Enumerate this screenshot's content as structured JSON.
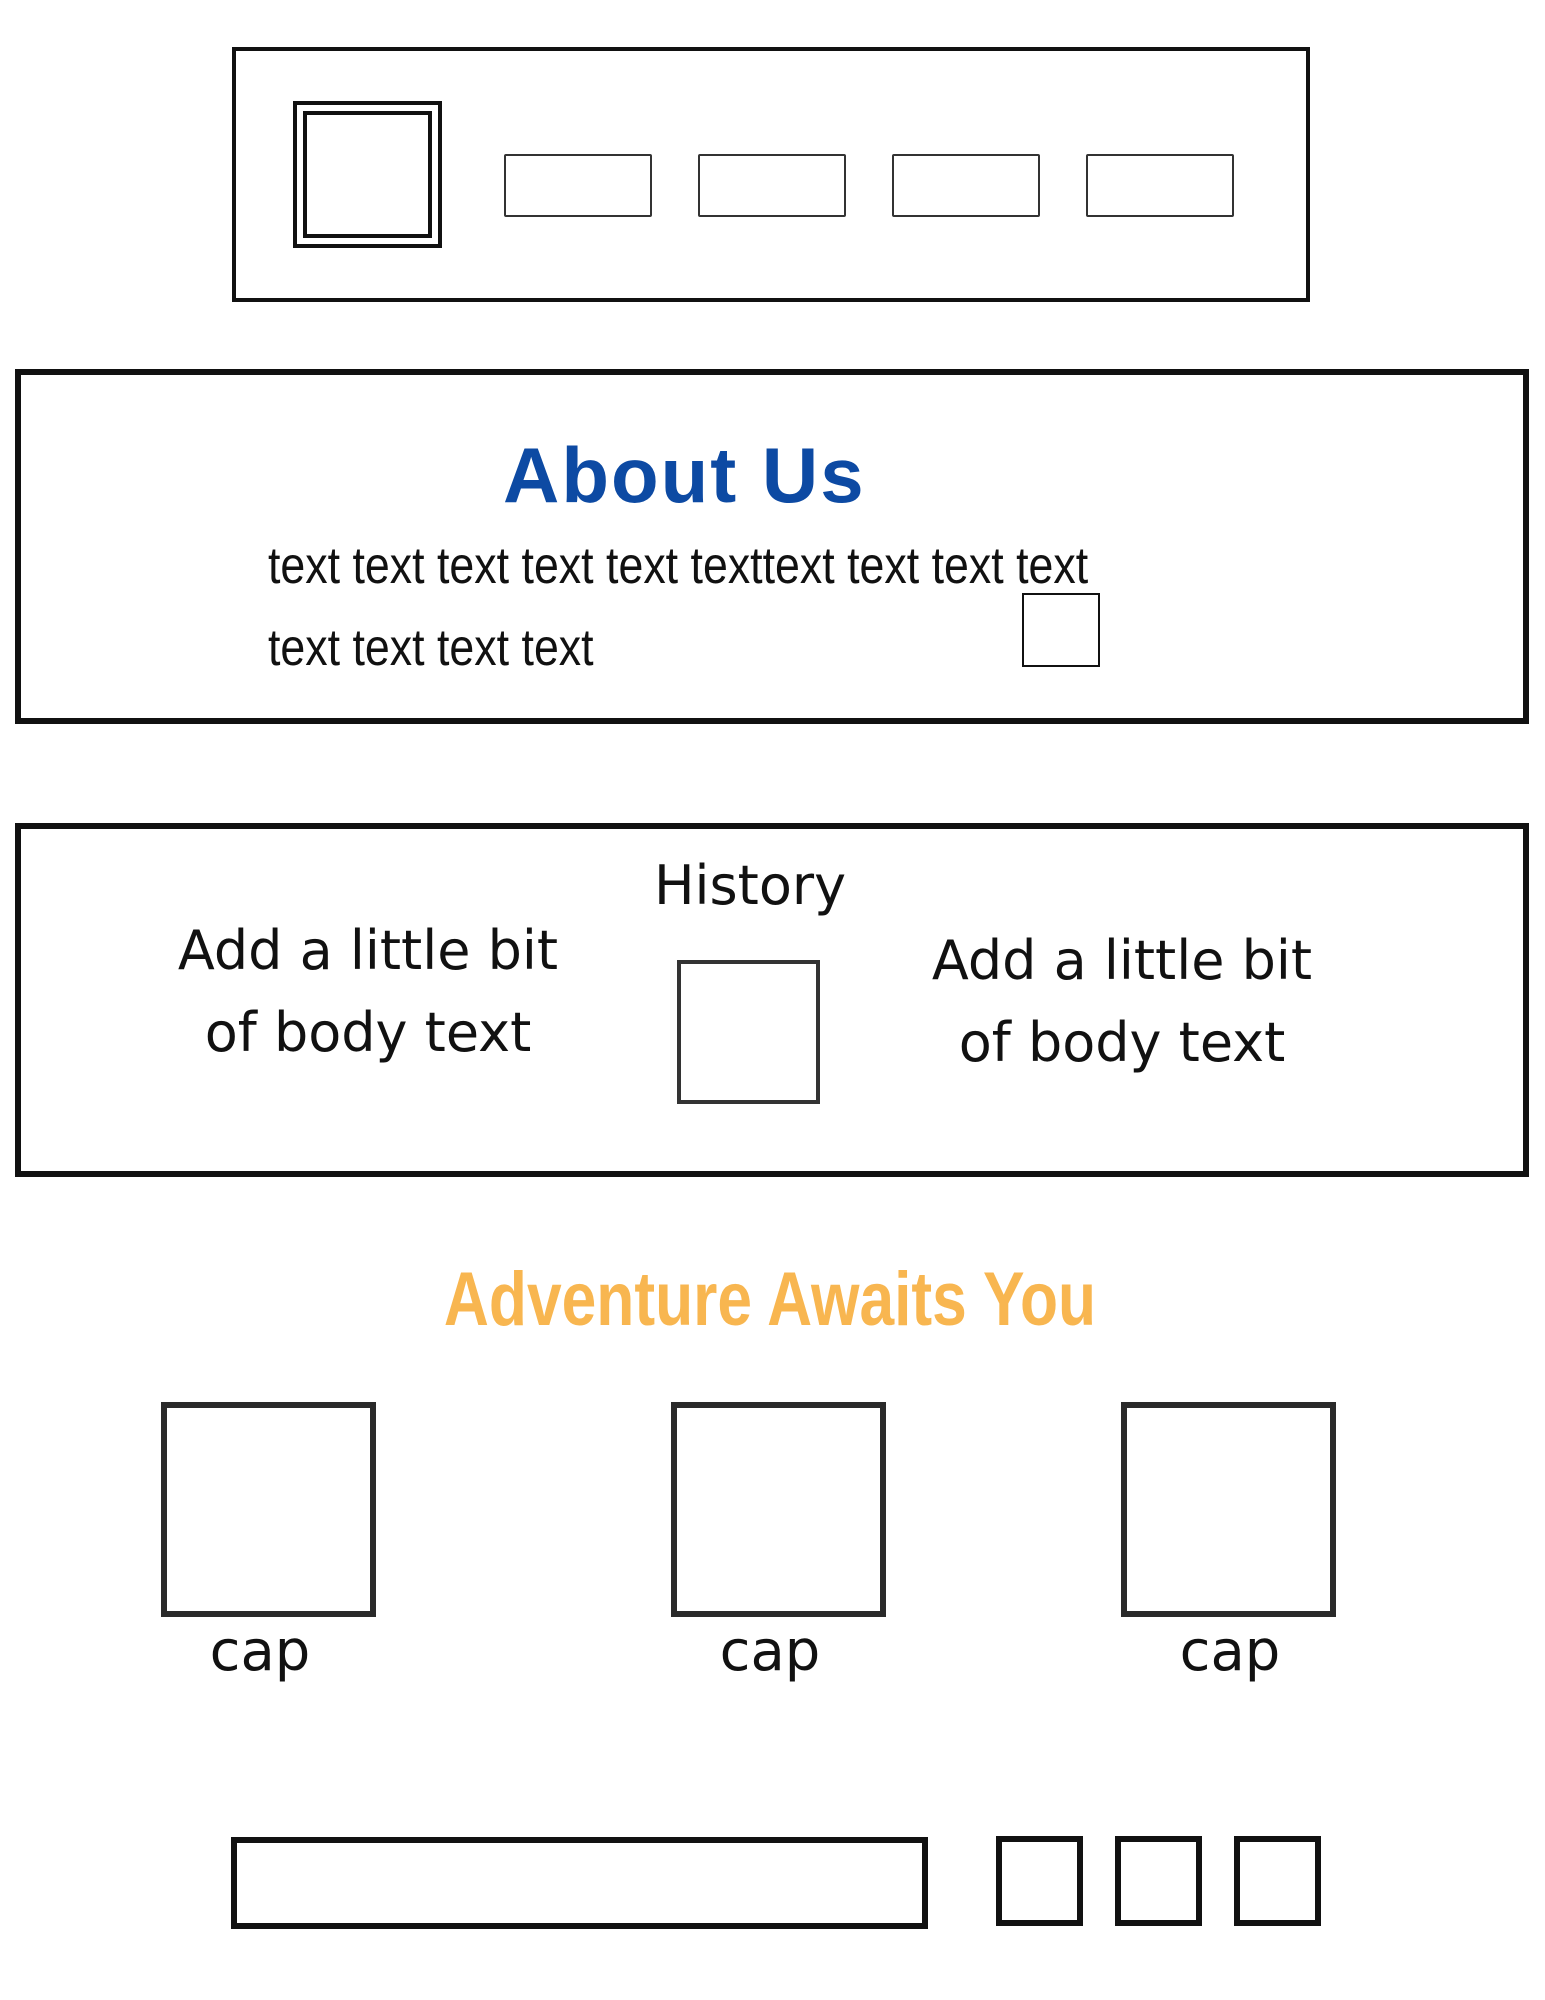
{
  "about": {
    "title": "About Us",
    "text_line1": "text text text text text texttext text text text",
    "text_line2": "text text text text"
  },
  "history": {
    "title": "History",
    "left_text_line1": "Add a little bit",
    "left_text_line2": "of body text",
    "right_text_line1": "Add a little bit",
    "right_text_line2": "of body text"
  },
  "adventure": {
    "title": "Adventure Awaits You",
    "captions": [
      "cap",
      "cap",
      "cap"
    ]
  },
  "colors": {
    "about_title": "#0d4aa3",
    "adventure_title": "#f8b650",
    "outline": "#111111",
    "background": "#ffffff"
  }
}
